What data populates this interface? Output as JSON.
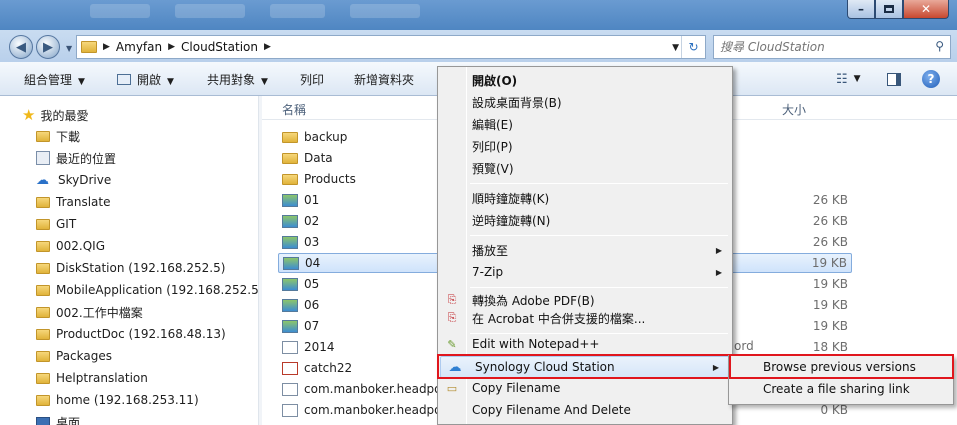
{
  "address": {
    "crumbs": [
      "Amyfan",
      "CloudStation"
    ]
  },
  "search": {
    "placeholder": "搜尋 CloudStation"
  },
  "toolbar": {
    "organize": "組合管理",
    "open": "開啟",
    "share": "共用對象",
    "print": "列印",
    "new_folder": "新增資料夾"
  },
  "nav": {
    "favorites": "我的最愛",
    "items": [
      "下載",
      "最近的位置",
      "SkyDrive",
      "Translate",
      "GIT",
      "002.QIG",
      "DiskStation (192.168.252.5)",
      "MobileApplication (192.168.252.5",
      "002.工作中檔案",
      "ProductDoc (192.168.48.13)",
      "Packages",
      "Helptranslation",
      "home (192.168.253.11)",
      "桌面"
    ]
  },
  "columns": {
    "name": "名稱",
    "size": "大小"
  },
  "files": [
    {
      "name": "backup",
      "size": ""
    },
    {
      "name": "Data",
      "size": ""
    },
    {
      "name": "Products",
      "size": ""
    },
    {
      "name": "01",
      "size": "26 KB"
    },
    {
      "name": "02",
      "size": "26 KB"
    },
    {
      "name": "03",
      "size": "26 KB"
    },
    {
      "name": "04",
      "size": "19 KB"
    },
    {
      "name": "05",
      "size": "19 KB"
    },
    {
      "name": "06",
      "size": "19 KB"
    },
    {
      "name": "07",
      "size": "19 KB"
    },
    {
      "name": "2014",
      "size": "18 KB"
    },
    {
      "name": "catch22",
      "size": ""
    },
    {
      "name": "com.manboker.headpo",
      "size": ""
    },
    {
      "name": "com.manboker.headpo",
      "size": "0 KB"
    }
  ],
  "file_type_fragment": "ord",
  "context_menu": {
    "items": [
      "開啟(O)",
      "設成桌面背景(B)",
      "編輯(E)",
      "列印(P)",
      "預覽(V)",
      "順時鐘旋轉(K)",
      "逆時鐘旋轉(N)",
      "播放至",
      "7-Zip",
      "轉換為 Adobe PDF(B)",
      "在 Acrobat 中合併支援的檔案...",
      "Edit with Notepad++",
      "Synology Cloud Station",
      "Copy Filename",
      "Copy Filename And Delete"
    ]
  },
  "submenu": {
    "items": [
      "Browse previous versions",
      "Create a file sharing link"
    ]
  },
  "colors": {
    "highlight_border": "#e0161d",
    "selection": "#cfe3fb"
  }
}
